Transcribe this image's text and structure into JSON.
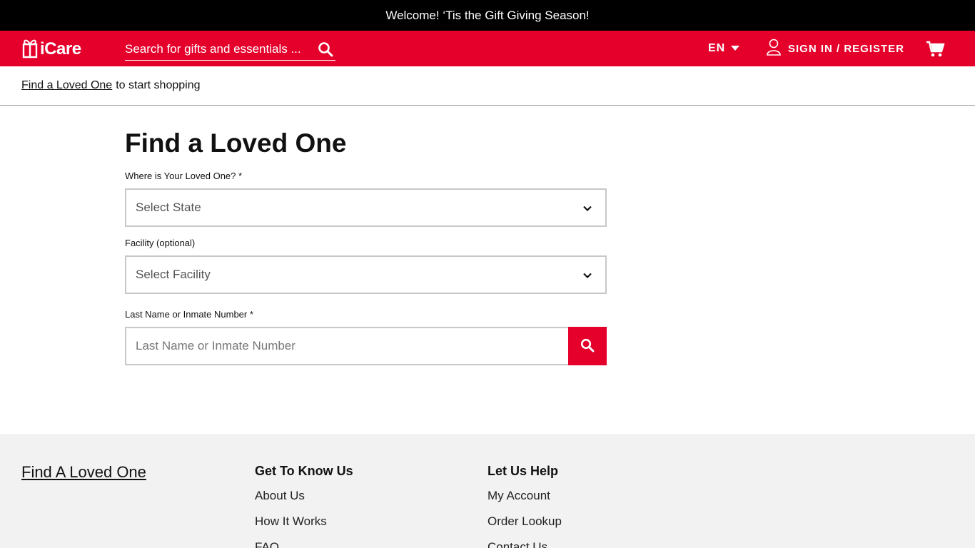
{
  "promo": {
    "text": "Welcome! ‘Tis the Gift Giving Season!"
  },
  "header": {
    "logo_text": "iCare",
    "search_placeholder": "Search for gifts and essentials ...",
    "language": "EN",
    "signin_label": "SIGN IN / REGISTER",
    "icons": [
      "gift-logo-icon",
      "search-icon",
      "caret-down-icon",
      "user-icon",
      "cart-icon"
    ]
  },
  "subbar": {
    "link": "Find a Loved One",
    "suffix": "to start shopping"
  },
  "main": {
    "title": "Find a Loved One",
    "state_label": "Where is Your Loved One? *",
    "state_value": "Select State",
    "facility_label": "Facility (optional)",
    "facility_value": "Select Facility",
    "name_label": "Last Name or Inmate Number *",
    "name_placeholder": "Last Name or Inmate Number"
  },
  "footer": {
    "find_link": "Find A Loved One",
    "col1": {
      "heading": "Get To Know Us",
      "links": [
        "About Us",
        "How It Works",
        "FAQ"
      ]
    },
    "col2": {
      "heading": "Let Us Help",
      "links": [
        "My Account",
        "Order Lookup",
        "Contact Us"
      ]
    }
  },
  "colors": {
    "brand_red": "#e4002b",
    "promo_black": "#000000",
    "footer_gray": "#f2f2f2"
  }
}
